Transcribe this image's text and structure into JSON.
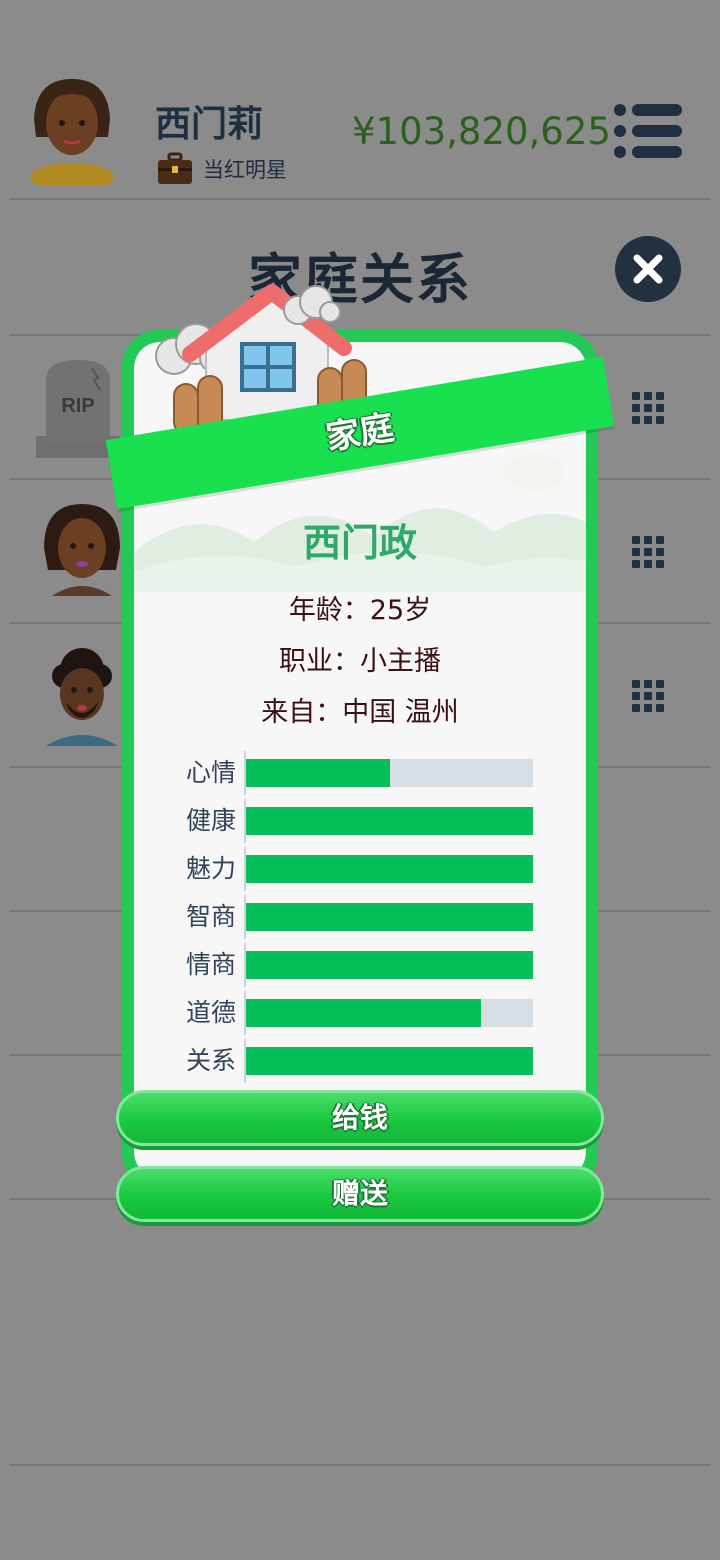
{
  "header": {
    "player_name": "西门莉",
    "job": "当红明星",
    "money": "¥103,820,625"
  },
  "section": {
    "title": "家庭关系"
  },
  "modal": {
    "banner": "家庭",
    "member": {
      "name": "西门政",
      "age": "年龄：25岁",
      "job": "职业：小主播",
      "from": "来自：中国 温州"
    },
    "stats": [
      {
        "label": "心情",
        "value": 0.5
      },
      {
        "label": "健康",
        "value": 1.0
      },
      {
        "label": "魅力",
        "value": 1.0
      },
      {
        "label": "智商",
        "value": 1.0
      },
      {
        "label": "情商",
        "value": 1.0
      },
      {
        "label": "道德",
        "value": 0.82
      },
      {
        "label": "关系",
        "value": 1.0
      }
    ],
    "buttons": {
      "give_money": "给钱",
      "gift": "赠送"
    }
  },
  "rows": [
    {
      "avatar_icon": "rip-tombstone-icon",
      "tomb_text": "RIP"
    },
    {
      "avatar_icon": "female-avatar-icon"
    },
    {
      "avatar_icon": "male-avatar-icon"
    }
  ],
  "colors": {
    "overlay": "#8b8b8b",
    "modal_frame": "#22c955",
    "bar_fill": "#06bf5a",
    "bar_track": "#d6dde3",
    "money": "#2b5f1e"
  }
}
